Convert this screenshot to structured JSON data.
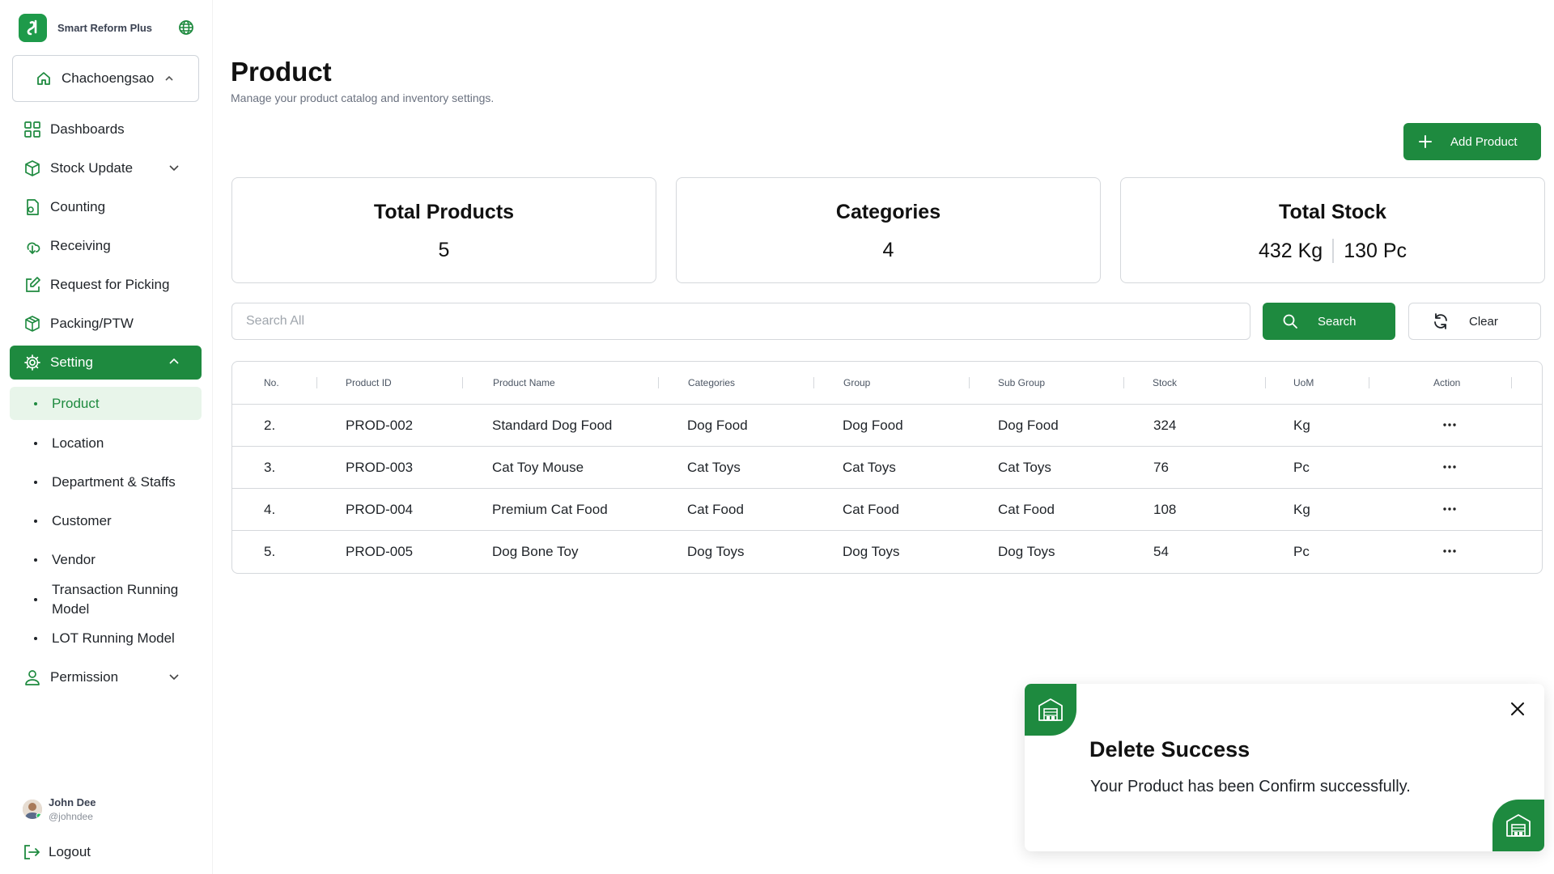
{
  "app": {
    "name": "Smart Reform Plus",
    "branch": "Chachoengsao"
  },
  "sidebar": {
    "items": [
      {
        "label": "Dashboards"
      },
      {
        "label": "Stock Update"
      },
      {
        "label": "Counting"
      },
      {
        "label": "Receiving"
      },
      {
        "label": "Request for Picking"
      },
      {
        "label": "Packing/PTW"
      },
      {
        "label": "Setting"
      },
      {
        "label": "Permission"
      }
    ],
    "setting_sub": [
      {
        "label": "Product"
      },
      {
        "label": "Location"
      },
      {
        "label": "Department & Staffs"
      },
      {
        "label": "Customer"
      },
      {
        "label": "Vendor"
      },
      {
        "label": "Transaction Running Model"
      },
      {
        "label": "LOT Running Model"
      }
    ],
    "user": {
      "name": "John Dee",
      "handle": "@johndee"
    },
    "logout_label": "Logout"
  },
  "header": {
    "title": "Product",
    "subtitle": "Manage your product catalog and inventory settings.",
    "add_label": "Add Product"
  },
  "stats": {
    "total_products": {
      "label": "Total Products",
      "value": "5"
    },
    "categories": {
      "label": "Categories",
      "value": "4"
    },
    "total_stock": {
      "label": "Total Stock",
      "kg": "432 Kg",
      "pc": "130 Pc"
    }
  },
  "search": {
    "placeholder": "Search All",
    "button": "Search",
    "clear": "Clear"
  },
  "table": {
    "columns": [
      "No.",
      "Product ID",
      "Product Name",
      "Categories",
      "Group",
      "Sub Group",
      "Stock",
      "UoM",
      "Action"
    ],
    "rows": [
      {
        "no": "2.",
        "id": "PROD-002",
        "name": "Standard Dog Food",
        "category": "Dog Food",
        "group": "Dog Food",
        "subgroup": "Dog Food",
        "stock": "324",
        "uom": "Kg"
      },
      {
        "no": "3.",
        "id": "PROD-003",
        "name": "Cat Toy Mouse",
        "category": "Cat Toys",
        "group": "Cat Toys",
        "subgroup": "Cat Toys",
        "stock": "76",
        "uom": "Pc"
      },
      {
        "no": "4.",
        "id": "PROD-004",
        "name": "Premium Cat Food",
        "category": "Cat Food",
        "group": "Cat Food",
        "subgroup": "Cat Food",
        "stock": "108",
        "uom": "Kg"
      },
      {
        "no": "5.",
        "id": "PROD-005",
        "name": "Dog Bone Toy",
        "category": "Dog Toys",
        "group": "Dog Toys",
        "subgroup": "Dog Toys",
        "stock": "54",
        "uom": "Pc"
      }
    ]
  },
  "toast": {
    "title": "Delete Success",
    "message": "Your Product has been Confirm successfully."
  },
  "colors": {
    "primary": "#1e8a3f",
    "active_sub_bg": "#e8f5ea"
  },
  "icons": {
    "nav": [
      "dashboard-icon",
      "box-icon",
      "counting-icon",
      "receiving-icon",
      "edit-icon",
      "package-icon",
      "gear-icon",
      "user-icon"
    ]
  }
}
